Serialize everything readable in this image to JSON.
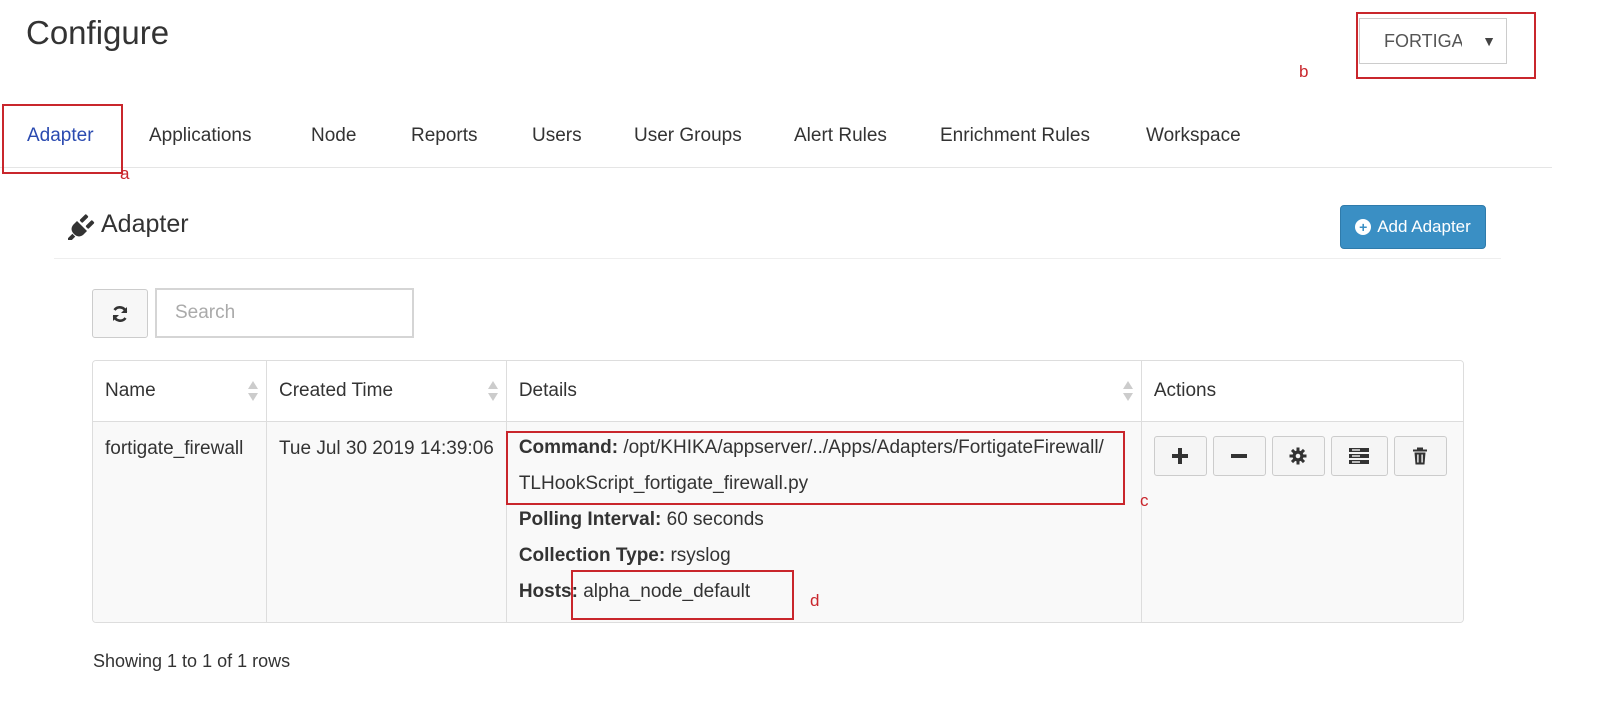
{
  "page": {
    "title": "Configure"
  },
  "workspace_select": {
    "value": "FORTIGATE"
  },
  "annotations": {
    "a": "a",
    "b": "b",
    "c": "c",
    "d": "d"
  },
  "tabs": [
    {
      "label": "Adapter",
      "active": true
    },
    {
      "label": "Applications"
    },
    {
      "label": "Node"
    },
    {
      "label": "Reports"
    },
    {
      "label": "Users"
    },
    {
      "label": "User Groups"
    },
    {
      "label": "Alert Rules"
    },
    {
      "label": "Enrichment Rules"
    },
    {
      "label": "Workspace"
    }
  ],
  "panel": {
    "title": "Adapter",
    "icon": "plug-icon",
    "add_button": "Add Adapter"
  },
  "toolbar": {
    "search_placeholder": "Search",
    "refresh_icon": "refresh-icon"
  },
  "table": {
    "columns": [
      "Name",
      "Created Time",
      "Details",
      "Actions"
    ],
    "rows": [
      {
        "name": "fortigate_firewall",
        "created": "Tue Jul 30 2019 14:39:06",
        "command_label": "Command:",
        "command_line1": "/opt/KHIKA/appserver/../Apps/Adapters/FortigateFirewall/",
        "command_line2": "TLHookScript_fortigate_firewall.py",
        "polling_label": "Polling Interval:",
        "polling_value": "60 seconds",
        "collection_label": "Collection Type:",
        "collection_value": "rsyslog",
        "hosts_label": "Hosts:",
        "hosts_value": "alpha_node_default"
      }
    ],
    "actions": [
      "plus-icon",
      "minus-icon",
      "gear-icon",
      "server-icon",
      "trash-icon"
    ]
  },
  "footer": {
    "pagination": "Showing 1 to 1 of 1 rows"
  },
  "colors": {
    "accent": "#3a8fc4",
    "active_tab": "#2a4ab0",
    "annotation": "#c9262c"
  }
}
